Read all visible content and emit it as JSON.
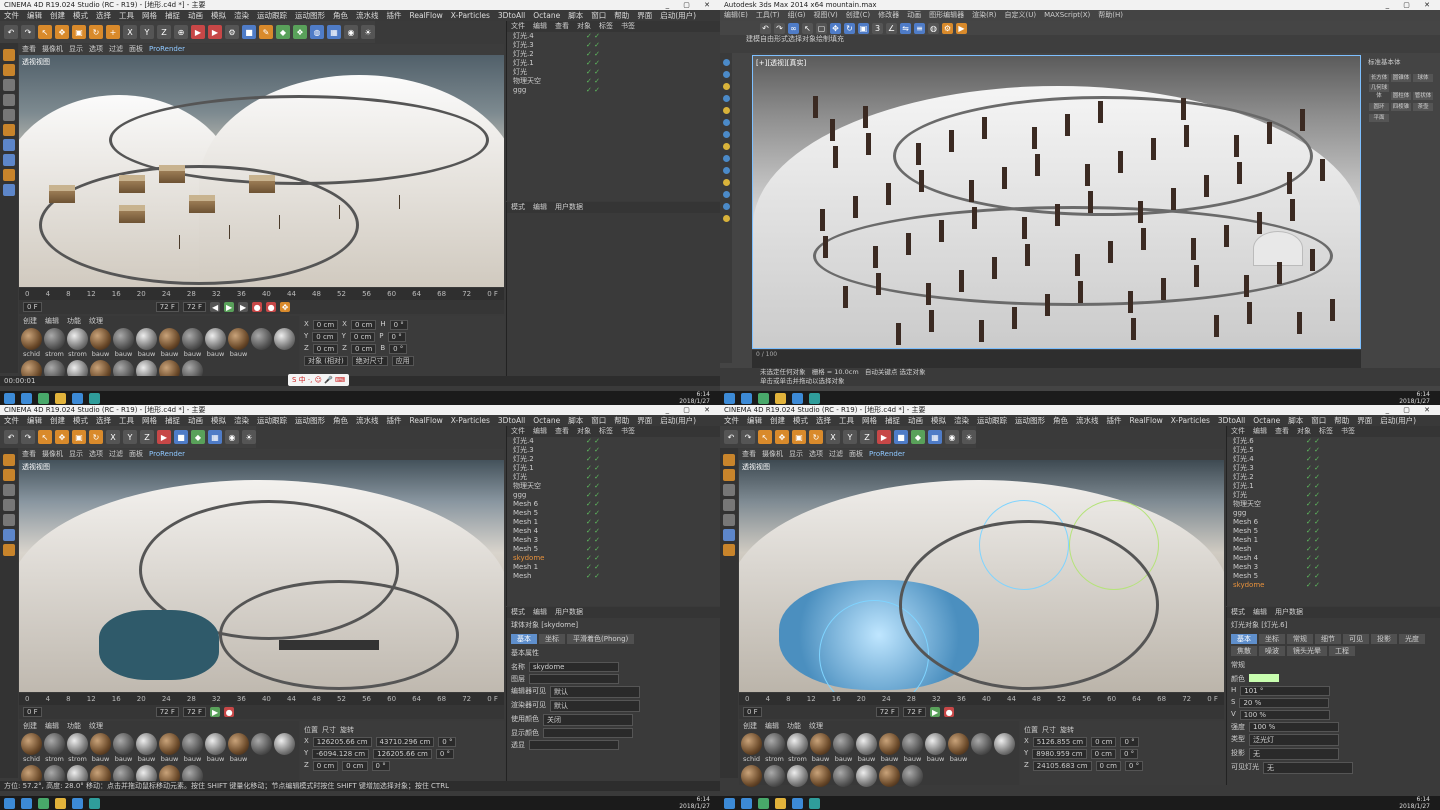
{
  "q1": {
    "title": "CINEMA 4D R19.024 Studio (RC - R19) - [地形.c4d *] - 主要",
    "menu": [
      "文件",
      "编辑",
      "创建",
      "模式",
      "选择",
      "工具",
      "网格",
      "捕捉",
      "动画",
      "模拟",
      "渲染",
      "运动跟踪",
      "运动图形",
      "角色",
      "流水线",
      "插件",
      "RealFlow",
      "X-Particles",
      "3DtoAll",
      "Octane",
      "脚本",
      "窗口",
      "帮助",
      "界面",
      "启动(用户)"
    ],
    "viewport_menu": [
      "查看",
      "摄像机",
      "显示",
      "选项",
      "过滤",
      "面板",
      "ProRender"
    ],
    "viewport_label": "透视视图",
    "timeline_ticks": [
      "0",
      "4",
      "8",
      "12",
      "16",
      "20",
      "24",
      "28",
      "32",
      "36",
      "40",
      "44",
      "48",
      "52",
      "56",
      "60",
      "64",
      "68",
      "72",
      "0 F"
    ],
    "frame_start": "0 F",
    "frame_end": "72 F",
    "frame_end2": "72 F",
    "mat_tabs": [
      "创建",
      "编辑",
      "功能",
      "纹理"
    ],
    "mats": [
      "schid",
      "strom",
      "strom",
      "bauw",
      "bauw",
      "bauw",
      "bauw",
      "bauw",
      "bauw",
      "bauw"
    ],
    "coords": {
      "x": "0 cm",
      "y": "0 cm",
      "z": "0 cm",
      "x2": "0 cm",
      "y2": "0 cm",
      "z2": "0 cm",
      "h": "0 °",
      "p": "0 °",
      "b": "0 °"
    },
    "coord_mode": "对象 (相对)",
    "coord_mode2": "绝对尺寸",
    "apply": "应用",
    "objects": [
      "灯光.4",
      "灯光.3",
      "灯光.2",
      "灯光.1",
      "灯光",
      "物理天空",
      "ggg"
    ],
    "om_tabs": [
      "文件",
      "编辑",
      "查看",
      "对象",
      "标签",
      "书签"
    ],
    "am_tabs": [
      "模式",
      "编辑",
      "用户数据"
    ],
    "status": "00:00:01"
  },
  "q2": {
    "title": "Autodesk 3ds Max 2014 x64    mountain.max",
    "menu": [
      "编辑(E)",
      "工具(T)",
      "组(G)",
      "视图(V)",
      "创建(C)",
      "修改器",
      "动画",
      "图形编辑器",
      "渲染(R)",
      "自定义(U)",
      "MAXScript(X)",
      "帮助(H)"
    ],
    "ribbon": [
      "建模",
      "自由形式",
      "选择",
      "对象绘制",
      "填充"
    ],
    "viewport_label": "[+][透视][真实]",
    "right_btns": [
      "长方体",
      "圆锥体",
      "球体",
      "几何球体",
      "圆柱体",
      "管状体",
      "圆环",
      "四棱锥",
      "茶壶",
      "平面"
    ],
    "right_field": "标准基本体",
    "timeline": "0 / 100",
    "status1": "未选定任何对象",
    "status2": "单击或单击并拖动以选择对象",
    "grid": "栅格 = 10.0cm",
    "autokey": "自动关键点",
    "selected": "选定对象"
  },
  "q3": {
    "title": "CINEMA 4D R19.024 Studio (RC - R19) - [地形.c4d *] - 主要",
    "objects": [
      "灯光.4",
      "灯光.3",
      "灯光.2",
      "灯光.1",
      "灯光",
      "物理天空",
      "ggg",
      "Mesh 6",
      "Mesh 5",
      "Mesh 1",
      "Mesh 4",
      "Mesh 3",
      "Mesh 5",
      "skydome",
      "Mesh 1",
      "Mesh"
    ],
    "attr_title": "球体对象 [skydome]",
    "attr_tabs": [
      "基本",
      "坐标",
      "平滑着色(Phong)"
    ],
    "attr_section": "基本属性",
    "attr_props": [
      [
        "名称",
        "skydome"
      ],
      [
        "图层",
        ""
      ],
      [
        "编辑器可见",
        "默认"
      ],
      [
        "渲染器可见",
        "默认"
      ],
      [
        "使用颜色",
        "关闭"
      ],
      [
        "显示颜色",
        ""
      ],
      [
        "透显",
        ""
      ]
    ],
    "coords": {
      "x": "126205.66 cm",
      "y": "-6094.128 cm",
      "z": "0 cm",
      "x2": "43710.296 cm",
      "y2": "126205.66 cm",
      "z2": "0 cm",
      "h": "0 °",
      "p": "0 °",
      "b": "0 °"
    },
    "coord_head": [
      "位置",
      "尺寸",
      "旋转"
    ],
    "status": "方位: 57.2°, 高度: 28.0°    移动：点击并拖动鼠标移动元素。按住 SHIFT 键量化移动；节点编辑模式时按住 SHIFT 键增加选择对象；按住 CTRL"
  },
  "q4": {
    "objects": [
      "灯光.6",
      "灯光.5",
      "灯光.4",
      "灯光.3",
      "灯光.2",
      "灯光.1",
      "灯光",
      "物理天空",
      "ggg",
      "Mesh 6",
      "Mesh 5",
      "Mesh 1",
      "Mesh",
      "Mesh 4",
      "Mesh 3",
      "Mesh 5",
      "skydome"
    ],
    "attr_title": "灯光对象 [灯光.6]",
    "attr_tabs": [
      "基本",
      "坐标",
      "常规",
      "细节",
      "可见",
      "投影",
      "光度",
      "焦散",
      "噪波",
      "镜头光晕",
      "工程"
    ],
    "attr_section": "常规",
    "color_label": "颜色",
    "hsv": [
      [
        "H",
        "101 °"
      ],
      [
        "S",
        "20 %"
      ],
      [
        "V",
        "100 %"
      ]
    ],
    "props": [
      [
        "强度",
        "100 %"
      ],
      [
        "类型",
        "泛光灯"
      ],
      [
        "投影",
        "无"
      ],
      [
        "可见灯光",
        "无"
      ]
    ],
    "coords": {
      "x": "5126.855 cm",
      "y": "8980.959 cm",
      "z": "24105.683 cm",
      "x2": "0 cm",
      "y2": "0 cm",
      "z2": "0 cm",
      "h": "0 °",
      "p": "0 °",
      "b": "0 °"
    }
  },
  "taskbar": {
    "time": "6:14",
    "date": "2018/1/27"
  }
}
